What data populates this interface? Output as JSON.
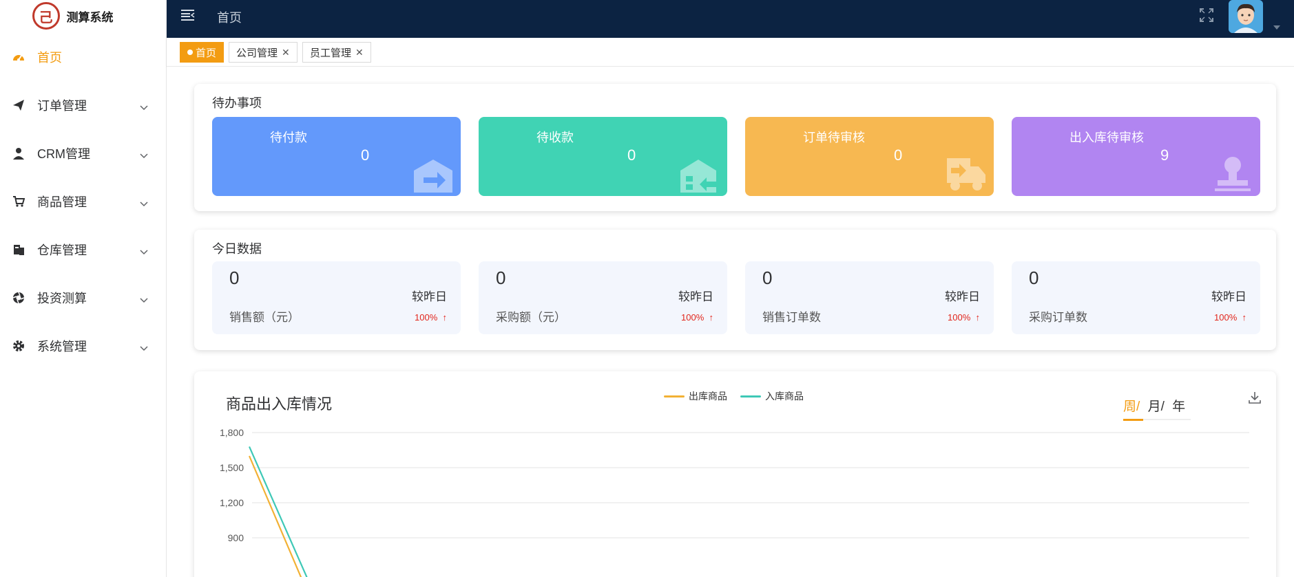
{
  "app": {
    "logo_text": "测算系统",
    "logo_glyph": "己"
  },
  "sidebar": {
    "items": [
      {
        "label": "首页",
        "icon": "dashboard-icon",
        "active": true
      },
      {
        "label": "订单管理",
        "icon": "paper-plane-icon"
      },
      {
        "label": "CRM管理",
        "icon": "user-icon"
      },
      {
        "label": "商品管理",
        "icon": "cart-icon"
      },
      {
        "label": "仓库管理",
        "icon": "warehouse-icon"
      },
      {
        "label": "投资测算",
        "icon": "aperture-icon"
      },
      {
        "label": "系统管理",
        "icon": "gear-icon"
      }
    ]
  },
  "header": {
    "title": "首页"
  },
  "tags": [
    {
      "label": "首页",
      "active": true
    },
    {
      "label": "公司管理",
      "closable": true
    },
    {
      "label": "员工管理",
      "closable": true
    }
  ],
  "pending": {
    "title": "待办事项",
    "cards": [
      {
        "label": "待付款",
        "value": "0",
        "color": "#6399fb",
        "icon": "box-arrow-icon"
      },
      {
        "label": "待收款",
        "value": "0",
        "color": "#40d3b4",
        "icon": "warehouse-in-icon"
      },
      {
        "label": "订单待审核",
        "value": "0",
        "color": "#f7b851",
        "icon": "truck-icon"
      },
      {
        "label": "出入库待审核",
        "value": "9",
        "color": "#b185f1",
        "icon": "stamp-icon"
      }
    ]
  },
  "today": {
    "title": "今日数据",
    "compare_label": "较昨日",
    "cards": [
      {
        "label": "销售额（元）",
        "value": "0",
        "change": "100%"
      },
      {
        "label": "采购额（元）",
        "value": "0",
        "change": "100%"
      },
      {
        "label": "销售订单数",
        "value": "0",
        "change": "100%"
      },
      {
        "label": "采购订单数",
        "value": "0",
        "change": "100%"
      }
    ]
  },
  "chart_section": {
    "title": "商品出入库情况",
    "periods": [
      "周/",
      "月/",
      "年"
    ],
    "active_period": "周/"
  },
  "chart_data": {
    "type": "line",
    "ylim": [
      900,
      1800
    ],
    "yticks": [
      "1,800",
      "1,500",
      "1,200",
      "900"
    ],
    "series": [
      {
        "name": "出库商品",
        "color": "#f2b134",
        "start": 1600
      },
      {
        "name": "入库商品",
        "color": "#3ec8b6",
        "start": 1680
      }
    ],
    "legend_placement": "top-center",
    "grid": true
  }
}
